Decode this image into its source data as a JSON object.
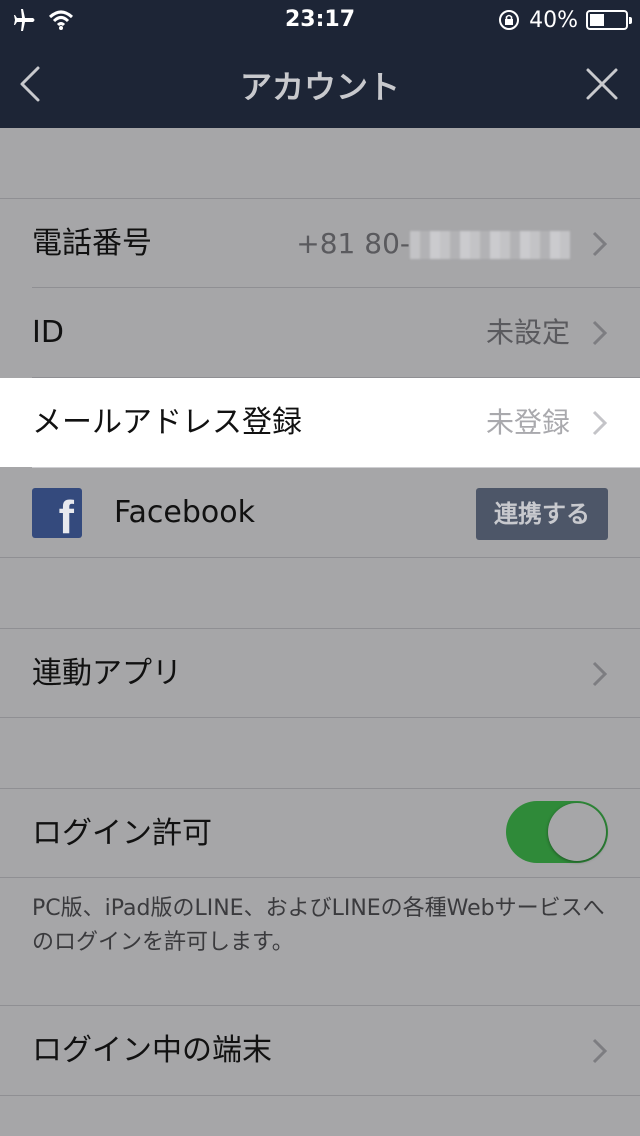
{
  "status_bar": {
    "time": "23:17",
    "battery_percent": "40%",
    "battery_level": 0.4
  },
  "nav": {
    "title": "アカウント"
  },
  "rows": {
    "phone": {
      "label": "電話番号",
      "value": "+81 80-"
    },
    "id": {
      "label": "ID",
      "value": "未設定"
    },
    "email": {
      "label": "メールアドレス登録",
      "value": "未登録"
    },
    "facebook": {
      "label": "Facebook",
      "button": "連携する"
    },
    "linked_apps": {
      "label": "連動アプリ"
    },
    "login_allow": {
      "label": "ログイン許可",
      "enabled": true
    },
    "login_devices": {
      "label": "ログイン中の端末"
    }
  },
  "login_description": "PC版、iPad版のLINE、およびLINEの各種Webサービスへのログインを許可します。",
  "colors": {
    "nav_background": "#1d2536",
    "toggle_on": "#2f8a39",
    "facebook_blue": "#344a7d",
    "highlight_row": "#ffffff"
  }
}
